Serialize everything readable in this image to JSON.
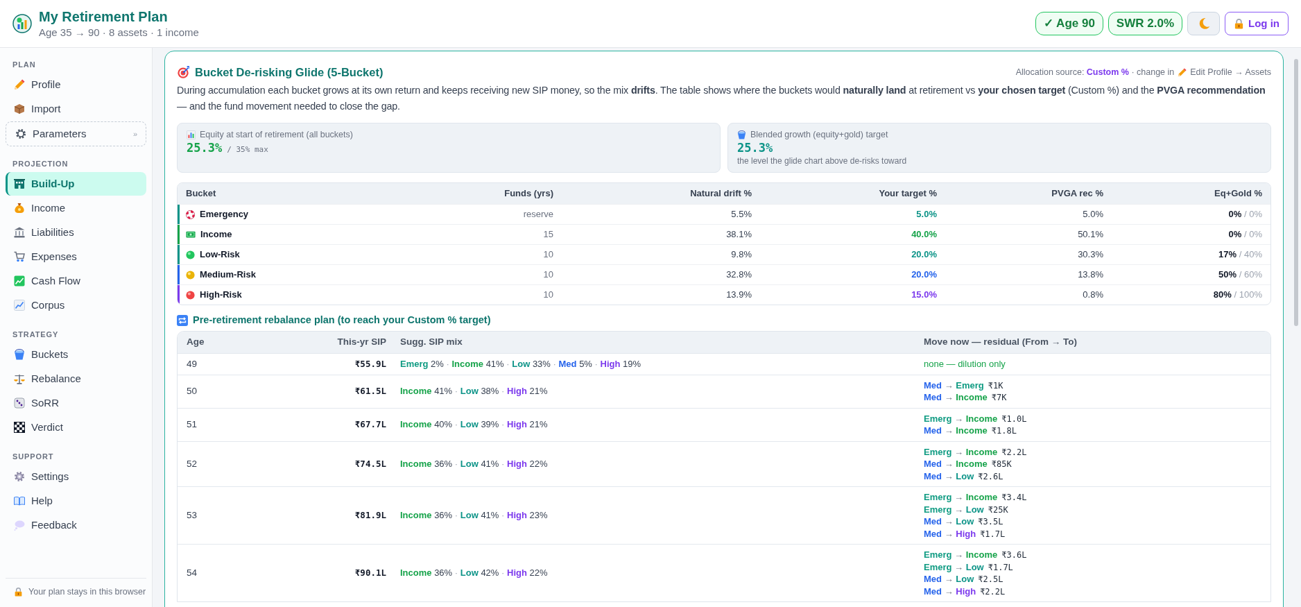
{
  "header": {
    "title": "My Retirement Plan",
    "subtitle": "Age 35 → 90 · 8 assets · 1 income",
    "badges": [
      {
        "label": "✓ Age 90"
      },
      {
        "label": "SWR 2.0%"
      }
    ],
    "login": "Log in"
  },
  "sidebar": {
    "sections": [
      {
        "title": "PLAN",
        "items": [
          {
            "label": "Profile",
            "kind": "link",
            "selected": false
          },
          {
            "label": "Import",
            "kind": "link",
            "selected": false
          },
          {
            "label": "Parameters",
            "kind": "expander",
            "selected": false,
            "chevron": "»"
          }
        ]
      },
      {
        "title": "PROJECTION",
        "items": [
          {
            "label": "Build-Up",
            "kind": "link",
            "selected": true
          },
          {
            "label": "Income",
            "kind": "link",
            "selected": false
          },
          {
            "label": "Liabilities",
            "kind": "link",
            "selected": false
          },
          {
            "label": "Expenses",
            "kind": "link",
            "selected": false
          },
          {
            "label": "Cash Flow",
            "kind": "link",
            "selected": false
          },
          {
            "label": "Corpus",
            "kind": "link",
            "selected": false
          }
        ]
      },
      {
        "title": "STRATEGY",
        "items": [
          {
            "label": "Buckets",
            "kind": "link",
            "selected": false
          },
          {
            "label": "Rebalance",
            "kind": "link",
            "selected": false
          },
          {
            "label": "SoRR",
            "kind": "link",
            "selected": false
          },
          {
            "label": "Verdict",
            "kind": "link",
            "selected": false
          }
        ]
      },
      {
        "title": "SUPPORT",
        "items": [
          {
            "label": "Settings",
            "kind": "link",
            "selected": false
          },
          {
            "label": "Help",
            "kind": "link",
            "selected": false
          },
          {
            "label": "Feedback",
            "kind": "link",
            "selected": false
          }
        ]
      }
    ],
    "footer": "Your plan stays in this browser"
  },
  "glide": {
    "title": "Bucket De-risking Glide (5-Bucket)",
    "source": "Allocation source: **Custom %** · change in",
    "source_link": "Edit Profile → Assets",
    "description": "During accumulation each bucket grows at its own return and keeps receiving new SIP money, so the mix **drifts**. The table shows where the buckets would **naturally land** at retirement vs **your chosen target** (Custom %) and the **PVGA recommendation** — and the fund movement needed to close the gap.",
    "stats": [
      {
        "label": "Equity at start of retirement (all buckets)",
        "value": "25.3%",
        "suffix": "/ 35% max"
      },
      {
        "label": "Blended growth (equity+gold) target",
        "value": "25.3%",
        "note": "the level the glide chart above de-risks toward"
      }
    ],
    "bucket_table": {
      "columns": [
        "Bucket",
        "Funds (yrs)",
        "Natural drift %",
        "Your target %",
        "PVGA rec %",
        "Eq+Gold %"
      ],
      "rows": [
        {
          "kind": "emergency",
          "name": "Emergency",
          "color": "#0d9488",
          "funds": "reserve",
          "drift": "5.5%",
          "target": "5.0%",
          "pvga": "5.0%",
          "eq_gold": "0%",
          "eq_gold_cap": "/ 0%"
        },
        {
          "kind": "income",
          "name": "Income",
          "color": "#16a34a",
          "funds": "15",
          "drift": "38.1%",
          "target": "40.0%",
          "pvga": "50.1%",
          "eq_gold": "0%",
          "eq_gold_cap": "/ 0%"
        },
        {
          "kind": "low",
          "name": "Low-Risk",
          "color": "#0d9488",
          "funds": "10",
          "drift": "9.8%",
          "target": "20.0%",
          "pvga": "30.3%",
          "eq_gold": "17%",
          "eq_gold_cap": "/ 40%"
        },
        {
          "kind": "medium",
          "name": "Medium-Risk",
          "color": "#2563eb",
          "funds": "10",
          "drift": "32.8%",
          "target": "20.0%",
          "pvga": "13.8%",
          "eq_gold": "50%",
          "eq_gold_cap": "/ 60%"
        },
        {
          "kind": "high",
          "name": "High-Risk",
          "color": "#7c3aed",
          "funds": "10",
          "drift": "13.9%",
          "target": "15.0%",
          "pvga": "0.8%",
          "eq_gold": "80%",
          "eq_gold_cap": "/ 100%"
        }
      ]
    }
  },
  "rebalance": {
    "title": "Pre-retirement rebalance plan (to reach your Custom % target)",
    "columns": [
      "Age",
      "This-yr SIP",
      "Sugg. SIP mix",
      "Move now — residual (From → To)"
    ],
    "rows": [
      {
        "age": "49",
        "sip": "₹55.9L",
        "mix": [
          {
            "name": "Emerg",
            "kind": "emergency",
            "share": "2%",
            "sep": "·"
          },
          {
            "name": "Income",
            "kind": "income",
            "share": "41%",
            "sep": "·"
          },
          {
            "name": "Low",
            "kind": "low",
            "share": "33%",
            "sep": "·"
          },
          {
            "name": "Med",
            "kind": "medium",
            "share": "5%",
            "sep": "·"
          },
          {
            "name": "High",
            "kind": "high",
            "share": "19%"
          }
        ],
        "note": "none — dilution only"
      },
      {
        "age": "50",
        "sip": "₹61.5L",
        "mix": [
          {
            "name": "Income",
            "kind": "income",
            "share": "41%",
            "sep": "·"
          },
          {
            "name": "Low",
            "kind": "low",
            "share": "38%",
            "sep": "·"
          },
          {
            "name": "High",
            "kind": "high",
            "share": "21%"
          }
        ],
        "moves": [
          {
            "from": {
              "label": "Med",
              "kind": "medium"
            },
            "arrow": "→",
            "to": {
              "label": "Emerg",
              "kind": "emergency"
            },
            "amount": "₹1K"
          },
          {
            "from": {
              "label": "Med",
              "kind": "medium"
            },
            "arrow": "→",
            "to": {
              "label": "Income",
              "kind": "income"
            },
            "amount": "₹7K"
          }
        ]
      },
      {
        "age": "51",
        "sip": "₹67.7L",
        "mix": [
          {
            "name": "Income",
            "kind": "income",
            "share": "40%",
            "sep": "·"
          },
          {
            "name": "Low",
            "kind": "low",
            "share": "39%",
            "sep": "·"
          },
          {
            "name": "High",
            "kind": "high",
            "share": "21%"
          }
        ],
        "moves": [
          {
            "from": {
              "label": "Emerg",
              "kind": "emergency"
            },
            "arrow": "→",
            "to": {
              "label": "Income",
              "kind": "income"
            },
            "amount": "₹1.0L"
          },
          {
            "from": {
              "label": "Med",
              "kind": "medium"
            },
            "arrow": "→",
            "to": {
              "label": "Income",
              "kind": "income"
            },
            "amount": "₹1.8L"
          }
        ]
      },
      {
        "age": "52",
        "sip": "₹74.5L",
        "mix": [
          {
            "name": "Income",
            "kind": "income",
            "share": "36%",
            "sep": "·"
          },
          {
            "name": "Low",
            "kind": "low",
            "share": "41%",
            "sep": "·"
          },
          {
            "name": "High",
            "kind": "high",
            "share": "22%"
          }
        ],
        "moves": [
          {
            "from": {
              "label": "Emerg",
              "kind": "emergency"
            },
            "arrow": "→",
            "to": {
              "label": "Income",
              "kind": "income"
            },
            "amount": "₹2.2L"
          },
          {
            "from": {
              "label": "Med",
              "kind": "medium"
            },
            "arrow": "→",
            "to": {
              "label": "Income",
              "kind": "income"
            },
            "amount": "₹85K"
          },
          {
            "from": {
              "label": "Med",
              "kind": "medium"
            },
            "arrow": "→",
            "to": {
              "label": "Low",
              "kind": "low"
            },
            "amount": "₹2.6L"
          }
        ]
      },
      {
        "age": "53",
        "sip": "₹81.9L",
        "mix": [
          {
            "name": "Income",
            "kind": "income",
            "share": "36%",
            "sep": "·"
          },
          {
            "name": "Low",
            "kind": "low",
            "share": "41%",
            "sep": "·"
          },
          {
            "name": "High",
            "kind": "high",
            "share": "23%"
          }
        ],
        "moves": [
          {
            "from": {
              "label": "Emerg",
              "kind": "emergency"
            },
            "arrow": "→",
            "to": {
              "label": "Income",
              "kind": "income"
            },
            "amount": "₹3.4L"
          },
          {
            "from": {
              "label": "Emerg",
              "kind": "emergency"
            },
            "arrow": "→",
            "to": {
              "label": "Low",
              "kind": "low"
            },
            "amount": "₹25K"
          },
          {
            "from": {
              "label": "Med",
              "kind": "medium"
            },
            "arrow": "→",
            "to": {
              "label": "Low",
              "kind": "low"
            },
            "amount": "₹3.5L"
          },
          {
            "from": {
              "label": "Med",
              "kind": "medium"
            },
            "arrow": "→",
            "to": {
              "label": "High",
              "kind": "high"
            },
            "amount": "₹1.7L"
          }
        ]
      },
      {
        "age": "54",
        "sip": "₹90.1L",
        "mix": [
          {
            "name": "Income",
            "kind": "income",
            "share": "36%",
            "sep": "·"
          },
          {
            "name": "Low",
            "kind": "low",
            "share": "42%",
            "sep": "·"
          },
          {
            "name": "High",
            "kind": "high",
            "share": "22%"
          }
        ],
        "moves": [
          {
            "from": {
              "label": "Emerg",
              "kind": "emergency"
            },
            "arrow": "→",
            "to": {
              "label": "Income",
              "kind": "income"
            },
            "amount": "₹3.6L"
          },
          {
            "from": {
              "label": "Emerg",
              "kind": "emergency"
            },
            "arrow": "→",
            "to": {
              "label": "Low",
              "kind": "low"
            },
            "amount": "₹1.7L"
          },
          {
            "from": {
              "label": "Med",
              "kind": "medium"
            },
            "arrow": "→",
            "to": {
              "label": "Low",
              "kind": "low"
            },
            "amount": "₹2.5L"
          },
          {
            "from": {
              "label": "Med",
              "kind": "medium"
            },
            "arrow": "→",
            "to": {
              "label": "High",
              "kind": "high"
            },
            "amount": "₹2.2L"
          }
        ]
      }
    ]
  }
}
